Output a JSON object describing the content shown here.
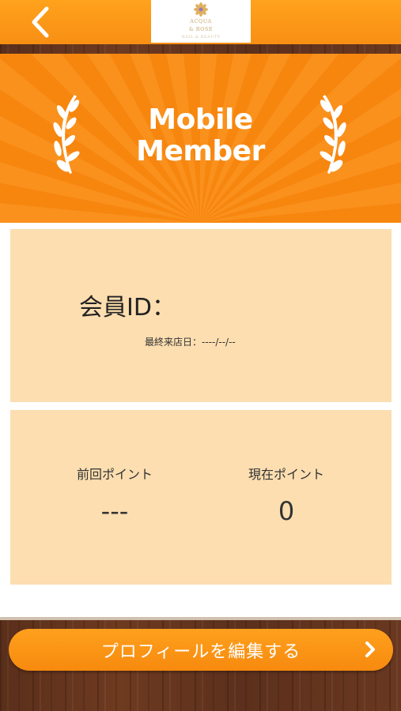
{
  "header": {
    "back_icon": "chevron-left-icon",
    "logo": {
      "line1": "ACQUA",
      "line2": "& ROSE",
      "line3": "NAIL & BEAUTY"
    }
  },
  "banner": {
    "title_line1": "Mobile",
    "title_line2": "Member",
    "icon": "laurel-icon"
  },
  "member_card": {
    "id_label": "会員ID：",
    "last_visit": "最終来店日：----/--/--"
  },
  "points": {
    "previous_label": "前回ポイント",
    "previous_value": "---",
    "current_label": "現在ポイント",
    "current_value": "0"
  },
  "footer": {
    "edit_profile_label": "プロフィールを編集する",
    "chevron_icon": "chevron-right-icon"
  },
  "colors": {
    "accent": "#f7860f",
    "card": "#fcdeb0",
    "wood": "#5e321d"
  }
}
